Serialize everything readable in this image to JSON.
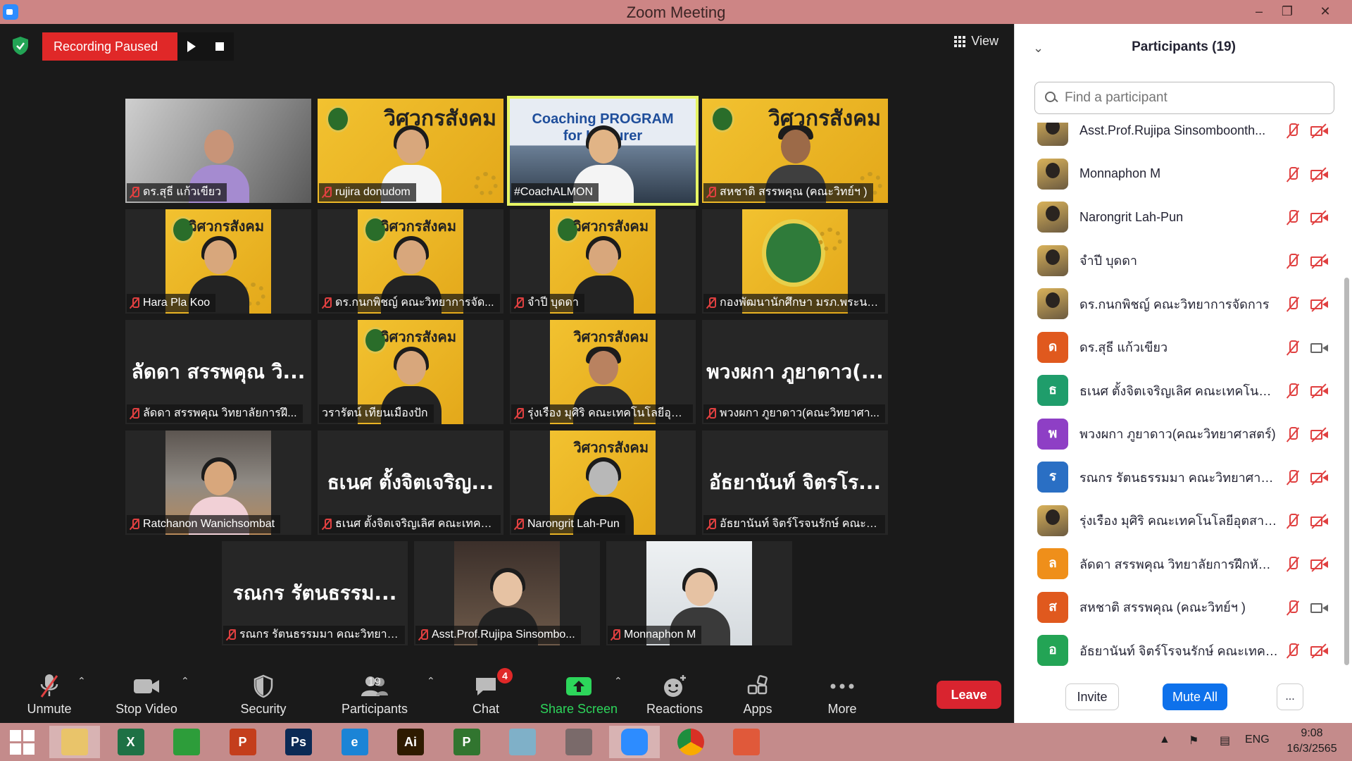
{
  "window": {
    "title": "Zoom Meeting"
  },
  "recording": {
    "status": "Recording Paused"
  },
  "view": {
    "label": "View"
  },
  "tiles": [
    {
      "name": "ดร.สุธี  แก้วเขียว"
    },
    {
      "name": "rujira donudom"
    },
    {
      "name": "#CoachALMON",
      "poster_text_1": "Coaching PROGRAM",
      "poster_text_2": "for Lecturer"
    },
    {
      "name": "สหชาติ สรรพคุณ (คณะวิทย์ฯ )"
    },
    {
      "name": "Hara Pla Koo"
    },
    {
      "name": "ดร.กนกพิชญ์ คณะวิทยาการจัด..."
    },
    {
      "name": "จำปี บุดดา"
    },
    {
      "name": "กองพัฒนานักศึกษา มรภ.พระนคร"
    },
    {
      "name": "ลัดดา สรรพคุณ วิทยาลัยการฝึ...",
      "display": "ลัดดา สรรพคุณ วิ..."
    },
    {
      "name": "วรารัตน์ เทียนเมืองปัก"
    },
    {
      "name": "รุ่งเรือง มุศิริ คณะเทคโนโลยีอุตส..."
    },
    {
      "name": "พวงผกา ภูยาดาว(คณะวิทยาศา...",
      "display": "พวงผกา ภูยาดาว(..."
    },
    {
      "name": "Ratchanon Wanichsombat"
    },
    {
      "name": "ธเนศ ตั้งจิตเจริญเลิศ คณะเทคโน...",
      "display": "ธเนศ ตั้งจิตเจริญ..."
    },
    {
      "name": "Narongrit Lah-Pun"
    },
    {
      "name": "อัธยานันท์ จิตร์โรจนรักษ์ คณะเท...",
      "display": "อัธยานันท์ จิตรโร..."
    },
    {
      "name": "รณกร รัตนธรรมมา คณะวิทยาศ...",
      "display": "รณกร รัตนธรรม..."
    },
    {
      "name": "Asst.Prof.Rujipa Sinsombo..."
    },
    {
      "name": "Monnaphon M"
    }
  ],
  "poster": {
    "brand": "วิศวกรสังคม"
  },
  "toolbar": {
    "unmute": "Unmute",
    "stop_video": "Stop Video",
    "security": "Security",
    "participants": "Participants",
    "participants_count": "19",
    "chat": "Chat",
    "chat_badge": "4",
    "share_screen": "Share Screen",
    "reactions": "Reactions",
    "apps": "Apps",
    "more": "More",
    "leave": "Leave"
  },
  "panel": {
    "title": "Participants (19)",
    "search_placeholder": "Find a participant",
    "participants": [
      {
        "name": "Asst.Prof.Rujipa Sinsomboonth...",
        "avatar": "",
        "color": "",
        "cam_on": false
      },
      {
        "name": "Monnaphon M",
        "avatar": "",
        "color": "",
        "cam_on": false
      },
      {
        "name": "Narongrit Lah-Pun",
        "avatar": "",
        "color": "",
        "cam_on": false
      },
      {
        "name": "จำปี บุดดา",
        "avatar": "",
        "color": "",
        "cam_on": false
      },
      {
        "name": "ดร.กนกพิชญ์ คณะวิทยาการจัดการ",
        "avatar": "",
        "color": "",
        "cam_on": false
      },
      {
        "name": "ดร.สุธี  แก้วเขียว",
        "avatar": "ด",
        "color": "#e0591e",
        "cam_on": true
      },
      {
        "name": "ธเนศ ตั้งจิตเจริญเลิศ คณะเทคโนโลยีอุ...",
        "avatar": "ธ",
        "color": "#1f9d6b",
        "cam_on": false
      },
      {
        "name": "พวงผกา ภูยาดาว(คณะวิทยาศาสตร์)",
        "avatar": "พ",
        "color": "#8e3fc5",
        "cam_on": false
      },
      {
        "name": "รณกร รัตนธรรมมา คณะวิทยาศาสตร์ฯ",
        "avatar": "ร",
        "color": "#2a6fc4",
        "cam_on": false
      },
      {
        "name": "รุ่งเรือง มุศิริ คณะเทคโนโลยีอุตสาหกรรม",
        "avatar": "",
        "color": "",
        "cam_on": false
      },
      {
        "name": "ลัดดา สรรพคุณ วิทยาลัยการฝึกหัดครู",
        "avatar": "ล",
        "color": "#ef8f1a",
        "cam_on": false
      },
      {
        "name": "สหชาติ สรรพคุณ (คณะวิทย์ฯ )",
        "avatar": "ส",
        "color": "#e0591e",
        "cam_on": true
      },
      {
        "name": "อัธยานันท์ จิตร์โรจนรักษ์ คณะเทคโนโล...",
        "avatar": "อ",
        "color": "#23a455",
        "cam_on": false
      }
    ],
    "invite": "Invite",
    "mute_all": "Mute All",
    "more": "..."
  },
  "taskbar": {
    "apps": [
      {
        "name": "file-explorer-icon",
        "label": "",
        "color": "#e9c46a"
      },
      {
        "name": "excel-icon",
        "label": "X",
        "color": "#1e7145"
      },
      {
        "name": "store-icon",
        "label": "",
        "color": "#2d9d3a"
      },
      {
        "name": "powerpoint-icon",
        "label": "P",
        "color": "#c43e1c"
      },
      {
        "name": "photoshop-icon",
        "label": "Ps",
        "color": "#0b2a55"
      },
      {
        "name": "internet-explorer-icon",
        "label": "e",
        "color": "#1b84d6"
      },
      {
        "name": "illustrator-icon",
        "label": "Ai",
        "color": "#2e1b00"
      },
      {
        "name": "project-icon",
        "label": "P",
        "color": "#31752f"
      },
      {
        "name": "notes-icon",
        "label": "",
        "color": "#7fb0c8"
      },
      {
        "name": "photoscape-icon",
        "label": "",
        "color": "#7a6a6a"
      },
      {
        "name": "zoom-icon",
        "label": "",
        "color": "#2d8cff"
      },
      {
        "name": "chrome-icon",
        "label": "",
        "color": "#d93025"
      },
      {
        "name": "presentation-icon",
        "label": "",
        "color": "#e0593a"
      }
    ],
    "language": "ENG",
    "time": "9:08",
    "date": "16/3/2565"
  }
}
